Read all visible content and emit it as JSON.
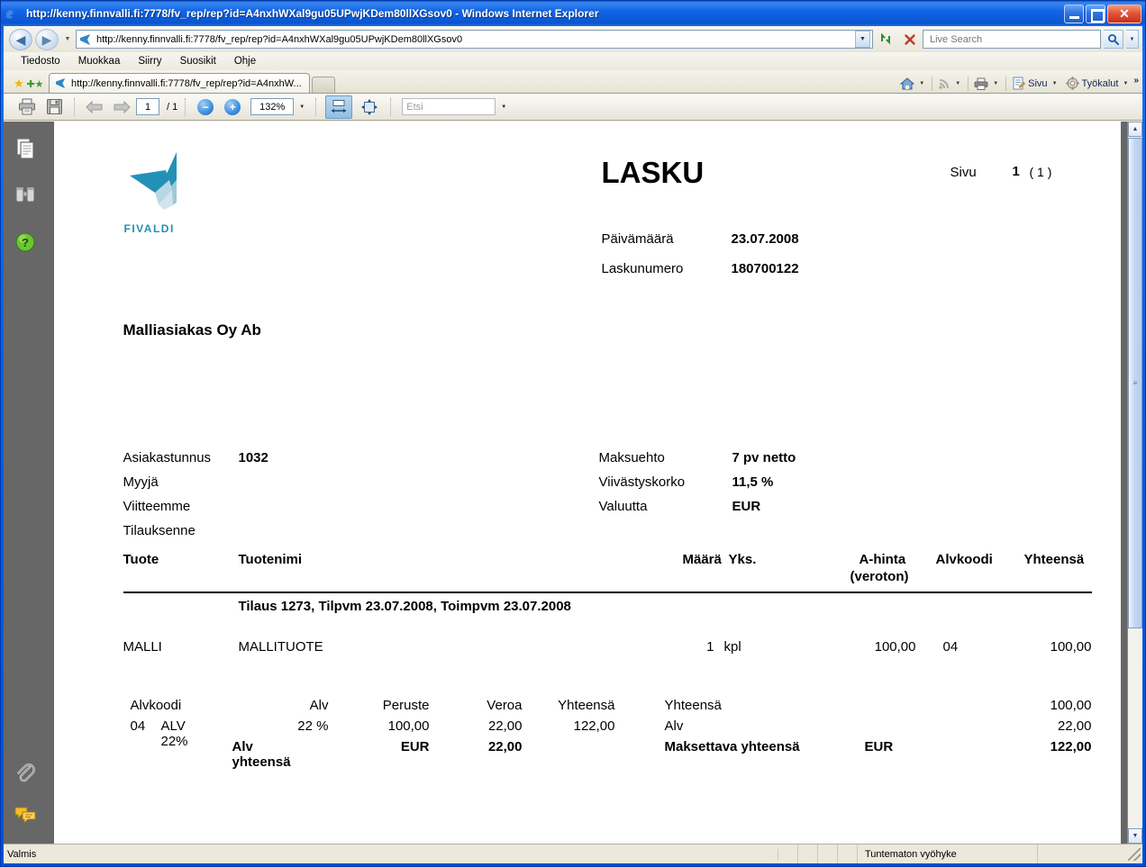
{
  "window": {
    "title": "http://kenny.finnvalli.fi:7778/fv_rep/rep?id=A4nxhWXal9gu05UPwjKDem80llXGsov0 - Windows Internet Explorer",
    "minimize_label": "Minimize",
    "maximize_label": "Maximize",
    "close_label": "✕"
  },
  "address_bar": {
    "url": "http://kenny.finnvalli.fi:7778/fv_rep/rep?id=A4nxhWXal9gu05UPwjKDem80llXGsov0",
    "search_placeholder": "Live Search",
    "search_value": ""
  },
  "menu": {
    "items": [
      "Tiedosto",
      "Muokkaa",
      "Siirry",
      "Suosikit",
      "Ohje"
    ]
  },
  "tabs": [
    {
      "label": "http://kenny.finnvalli.fi:7778/fv_rep/rep?id=A4nxhW..."
    }
  ],
  "command_bar": {
    "home_label": "",
    "feeds_label": "",
    "print_label": "",
    "page_label": "Sivu",
    "tools_label": "Työkalut",
    "overflow_label": "»"
  },
  "pdf_toolbar": {
    "print_title": "Tulosta",
    "save_title": "Tallenna",
    "prev_title": "Edellinen",
    "next_title": "Seuraava",
    "page_number": "1",
    "page_total": "/ 1",
    "zoom_out": "−",
    "zoom_in": "+",
    "zoom_level": "132%",
    "find_placeholder": "Etsi",
    "find_value": ""
  },
  "sidebar": {
    "items": [
      {
        "name": "pages-panel",
        "label": "Sivut"
      },
      {
        "name": "search-panel",
        "label": "Haku"
      },
      {
        "name": "help-panel",
        "label": "Ohje"
      }
    ],
    "bottom_items": [
      {
        "name": "attachments-panel",
        "label": "Liitteet"
      },
      {
        "name": "comments-panel",
        "label": "Kommentit"
      }
    ]
  },
  "document": {
    "logo_text": "FIVALDI",
    "title": "LASKU",
    "page_label": "Sivu",
    "page_current": "1",
    "page_total": "( 1 )",
    "meta": [
      {
        "key": "Päivämäärä",
        "value": "23.07.2008"
      },
      {
        "key": "Laskunumero",
        "value": "180700122"
      }
    ],
    "customer_name": "Malliasiakas Oy Ab",
    "left_info": [
      {
        "key": "Asiakastunnus",
        "value": "1032"
      },
      {
        "key": "Myyjä",
        "value": ""
      },
      {
        "key": "Viitteemme",
        "value": ""
      },
      {
        "key": "Tilauksenne",
        "value": ""
      }
    ],
    "right_info": [
      {
        "key": "Maksuehto",
        "value": "7 pv netto"
      },
      {
        "key": "Viivästyskorko",
        "value": "11,5 %"
      },
      {
        "key": "Valuutta",
        "value": "EUR"
      }
    ],
    "table": {
      "headers": {
        "product": "Tuote",
        "product_name": "Tuotenimi",
        "qty": "Määrä",
        "unit": "Yks.",
        "unit_price": "A-hinta",
        "unit_price_sub": "(veroton)",
        "vat_code": "Alvkoodi",
        "total": "Yhteensä"
      },
      "group_row": "Tilaus 1273, Tilpvm 23.07.2008, Toimpvm 23.07.2008",
      "rows": [
        {
          "product": "MALLI",
          "product_name": "MALLITUOTE",
          "qty": "1",
          "unit": "kpl",
          "unit_price": "100,00",
          "vat_code": "04",
          "total": "100,00"
        }
      ]
    },
    "vat_summary": {
      "headers": {
        "code": "Alvkoodi",
        "vat": "Alv",
        "base": "Peruste",
        "tax": "Veroa",
        "total": "Yhteensä"
      },
      "rows": [
        {
          "code": "04",
          "code_name": "ALV 22%",
          "vat": "22 %",
          "base": "100,00",
          "tax": "22,00",
          "total": "122,00"
        }
      ],
      "footer": {
        "label": "Alv yhteensä",
        "currency": "EUR",
        "amount": "22,00"
      }
    },
    "totals": [
      {
        "label": "Yhteensä",
        "currency": "",
        "value": "100,00",
        "bold": false
      },
      {
        "label": "Alv",
        "currency": "",
        "value": "22,00",
        "bold": false
      },
      {
        "label": "Maksettava yhteensä",
        "currency": "EUR",
        "value": "122,00",
        "bold": true
      }
    ]
  },
  "status_bar": {
    "message": "Valmis",
    "zone": "Tuntematon vyöhyke"
  },
  "colors": {
    "title_bar": "#0a5ae0",
    "chrome_bg": "#f2f0e6",
    "viewer_bg": "#676767",
    "logo_primary": "#2391b6",
    "logo_light": "#a8cfdd",
    "accent_blue": "#3e8ede"
  }
}
